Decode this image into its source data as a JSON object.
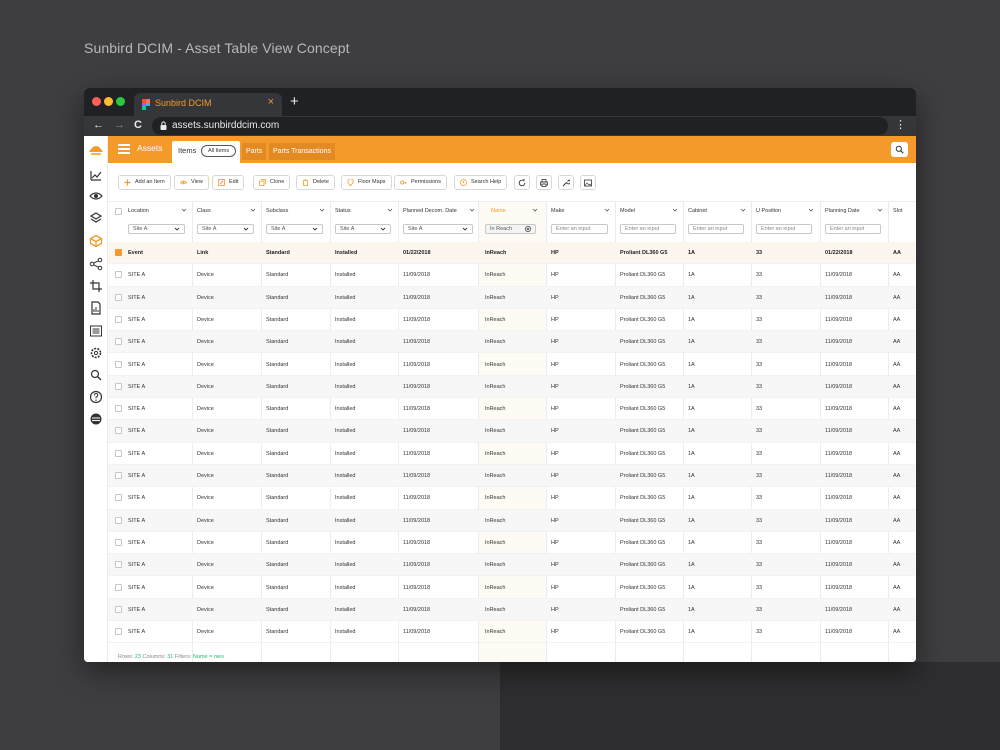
{
  "headline": "Sunbird DCIM - Asset Table View Concept",
  "browser": {
    "tab_title": "Sunbird DCIM",
    "tab_close": "×",
    "new_tab": "+",
    "url": "assets.sunbirddcim.com",
    "back": "←",
    "forward": "→",
    "reload": "C",
    "menu": "⋮"
  },
  "colors": {
    "brand": "#f39a2b",
    "checkbox": "#f39a2b",
    "status_green": "#2bb673"
  },
  "sidebar": {
    "icons": [
      "chart-icon",
      "eye-icon",
      "layers-icon",
      "cube-icon",
      "share-icon",
      "crop-icon",
      "report-icon",
      "list-icon",
      "gear-icon",
      "search-icon",
      "help-icon",
      "database-icon"
    ]
  },
  "topbar": {
    "title": "Assets",
    "tabs": {
      "items": "Items",
      "items_pill": "All Items",
      "parts": "Parts",
      "parts_transactions": "Parts Transactions"
    }
  },
  "toolbar": {
    "add": "Add an Item",
    "view": "View",
    "edit": "Edit",
    "clone": "Clone",
    "delete": "Delete",
    "floor_maps": "Floor Maps",
    "permissions": "Permissions",
    "search_help": "Search Help"
  },
  "table": {
    "headers": [
      "Location",
      "Class",
      "Subclass",
      "Status",
      "Planned Decom. Date",
      "Name",
      "Make",
      "Model",
      "Cabinet",
      "U Position",
      "Planning Date",
      "Slot"
    ],
    "filters": [
      "Site A",
      "Site A",
      "Site A",
      "Site A",
      "Site A",
      "In Reach",
      "Enter an input",
      "Enter an input",
      "Enter an input",
      "Enter an input",
      "Enter an input",
      ""
    ],
    "selected_row": [
      "Event",
      "Link",
      "Standard",
      "Installed",
      "01/22/2018",
      "InReach",
      "HP",
      "Proliant DL360 G5",
      "1A",
      "33",
      "01/22/2018",
      "AA"
    ],
    "rows": [
      [
        "SITE A",
        "Device",
        "Standard",
        "Installed",
        "11/09/2018",
        "InReach",
        "HP",
        "Proliant DL360 G5",
        "1A",
        "33",
        "11/09/2018",
        "AA"
      ],
      [
        "SITE A",
        "Device",
        "Standard",
        "Installed",
        "11/09/2018",
        "InReach",
        "HP",
        "Proliant DL360 G5",
        "1A",
        "33",
        "11/09/2018",
        "AA"
      ],
      [
        "SITE A",
        "Device",
        "Standard",
        "Installed",
        "11/09/2018",
        "InReach",
        "HP",
        "Proliant DL360 G5",
        "1A",
        "33",
        "11/09/2018",
        "AA"
      ],
      [
        "SITE A",
        "Device",
        "Standard",
        "Installed",
        "11/09/2018",
        "InReach",
        "HP",
        "Proliant DL360 G5",
        "1A",
        "33",
        "11/09/2018",
        "AA"
      ],
      [
        "SITE A",
        "Device",
        "Standard",
        "Installed",
        "11/09/2018",
        "InReach",
        "HP",
        "Proliant DL360 G5",
        "1A",
        "33",
        "11/09/2018",
        "AA"
      ],
      [
        "SITE A",
        "Device",
        "Standard",
        "Installed",
        "11/09/2018",
        "InReach",
        "HP",
        "Proliant DL360 G5",
        "1A",
        "33",
        "11/09/2018",
        "AA"
      ],
      [
        "SITE A",
        "Device",
        "Standard",
        "Installed",
        "11/09/2018",
        "InReach",
        "HP",
        "Proliant DL360 G5",
        "1A",
        "33",
        "11/09/2018",
        "AA"
      ],
      [
        "SITE A",
        "Device",
        "Standard",
        "Installed",
        "11/09/2018",
        "InReach",
        "HP",
        "Proliant DL360 G5",
        "1A",
        "33",
        "11/09/2018",
        "AA"
      ],
      [
        "SITE A",
        "Device",
        "Standard",
        "Installed",
        "11/09/2018",
        "InReach",
        "HP",
        "Proliant DL360 G5",
        "1A",
        "33",
        "11/09/2018",
        "AA"
      ],
      [
        "SITE A",
        "Device",
        "Standard",
        "Installed",
        "11/09/2018",
        "InReach",
        "HP",
        "Proliant DL360 G5",
        "1A",
        "33",
        "11/09/2018",
        "AA"
      ],
      [
        "SITE A",
        "Device",
        "Standard",
        "Installed",
        "11/09/2018",
        "InReach",
        "HP",
        "Proliant DL360 G5",
        "1A",
        "33",
        "11/09/2018",
        "AA"
      ],
      [
        "SITE A",
        "Device",
        "Standard",
        "Installed",
        "11/09/2018",
        "InReach",
        "HP",
        "Proliant DL360 G5",
        "1A",
        "33",
        "11/09/2018",
        "AA"
      ],
      [
        "SITE A",
        "Device",
        "Standard",
        "Installed",
        "11/09/2018",
        "InReach",
        "HP",
        "Proliant DL360 G5",
        "1A",
        "33",
        "11/09/2018",
        "AA"
      ],
      [
        "SITE A",
        "Device",
        "Standard",
        "Installed",
        "11/09/2018",
        "InReach",
        "HP",
        "Proliant DL360 G5",
        "1A",
        "33",
        "11/09/2018",
        "AA"
      ],
      [
        "SITE A",
        "Device",
        "Standard",
        "Installed",
        "11/09/2018",
        "InReach",
        "HP",
        "Proliant DL360 G5",
        "1A",
        "33",
        "11/09/2018",
        "AA"
      ],
      [
        "SITE A",
        "Device",
        "Standard",
        "Installed",
        "11/09/2018",
        "InReach",
        "HP",
        "Proliant DL360 G5",
        "1A",
        "33",
        "11/09/2018",
        "AA"
      ],
      [
        "SITE A",
        "Device",
        "Standard",
        "Installed",
        "11/09/2018",
        "InReach",
        "HP",
        "Proliant DL360 G5",
        "1A",
        "33",
        "11/09/2018",
        "AA"
      ]
    ],
    "status": {
      "rows_label": "Rows:",
      "rows_value": "23",
      "cols_label": "Columns:",
      "cols_value": "31",
      "filters_label": "Filters:",
      "filters_value": "Name = nies"
    }
  }
}
